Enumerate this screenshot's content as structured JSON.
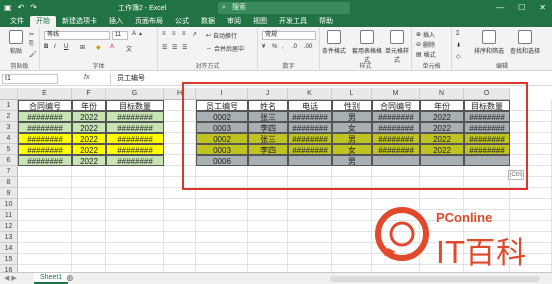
{
  "titlebar": {
    "title": "工作簿2 - Excel",
    "search_placeholder": "搜索",
    "qat_icons": [
      "save-icon",
      "undo-icon",
      "redo-icon"
    ]
  },
  "tabs": [
    "文件",
    "开始",
    "新建选项卡",
    "插入",
    "页面布局",
    "公式",
    "数据",
    "审阅",
    "视图",
    "开发工具",
    "帮助"
  ],
  "ribbon": {
    "paste": "粘贴",
    "clipboard": "剪贴板",
    "font_name": "等线",
    "font_size": "11",
    "font": "字体",
    "wrap": "自动换行",
    "merge": "合并后居中",
    "align": "对齐方式",
    "number_format": "常规",
    "number": "数字",
    "cond_format": "条件格式",
    "table_format": "套用表格格式",
    "cell_style": "单元格样式",
    "style": "样式",
    "insert": "插入",
    "delete": "删除",
    "format": "格式",
    "cells": "单元格",
    "sort_filter": "排序和筛选",
    "find_select": "查找和选择",
    "edit": "编辑"
  },
  "formula": {
    "namebox": "I1",
    "fx": "fx",
    "content": "员工编号"
  },
  "columns": [
    "E",
    "F",
    "G",
    "H",
    "I",
    "J",
    "K",
    "L",
    "M",
    "N",
    "O"
  ],
  "rows": [
    "1",
    "2",
    "3",
    "4",
    "5",
    "6",
    "7",
    "8",
    "9",
    "10",
    "11",
    "12",
    "13",
    "14",
    "15",
    "16"
  ],
  "left_table": {
    "headers": [
      "合同编号",
      "年份",
      "目标数量"
    ],
    "rows": [
      [
        "########",
        "2022",
        "########"
      ],
      [
        "########",
        "2022",
        "########"
      ],
      [
        "########",
        "2022",
        "########"
      ],
      [
        "########",
        "2022",
        "########"
      ],
      [
        "########",
        "2022",
        "########"
      ]
    ]
  },
  "right_table": {
    "headers": [
      "员工编号",
      "姓名",
      "电话",
      "性别",
      "合同编号",
      "年份",
      "目标数量"
    ],
    "rows": [
      [
        "0002",
        "张三",
        "########",
        "男",
        "########",
        "2022",
        "########"
      ],
      [
        "0003",
        "李四",
        "########",
        "女",
        "########",
        "2022",
        "########"
      ],
      [
        "0002",
        "张三",
        "########",
        "男",
        "########",
        "2022",
        "########"
      ],
      [
        "0003",
        "李四",
        "########",
        "女",
        "########",
        "2022",
        "########"
      ],
      [
        "0006",
        "",
        "",
        "男",
        "",
        "",
        ""
      ]
    ]
  },
  "quick_analysis": "(Ctrl)",
  "sheet_tab": "Sheet1",
  "watermark": {
    "brand": "PConline",
    "sub": "IT百科"
  }
}
